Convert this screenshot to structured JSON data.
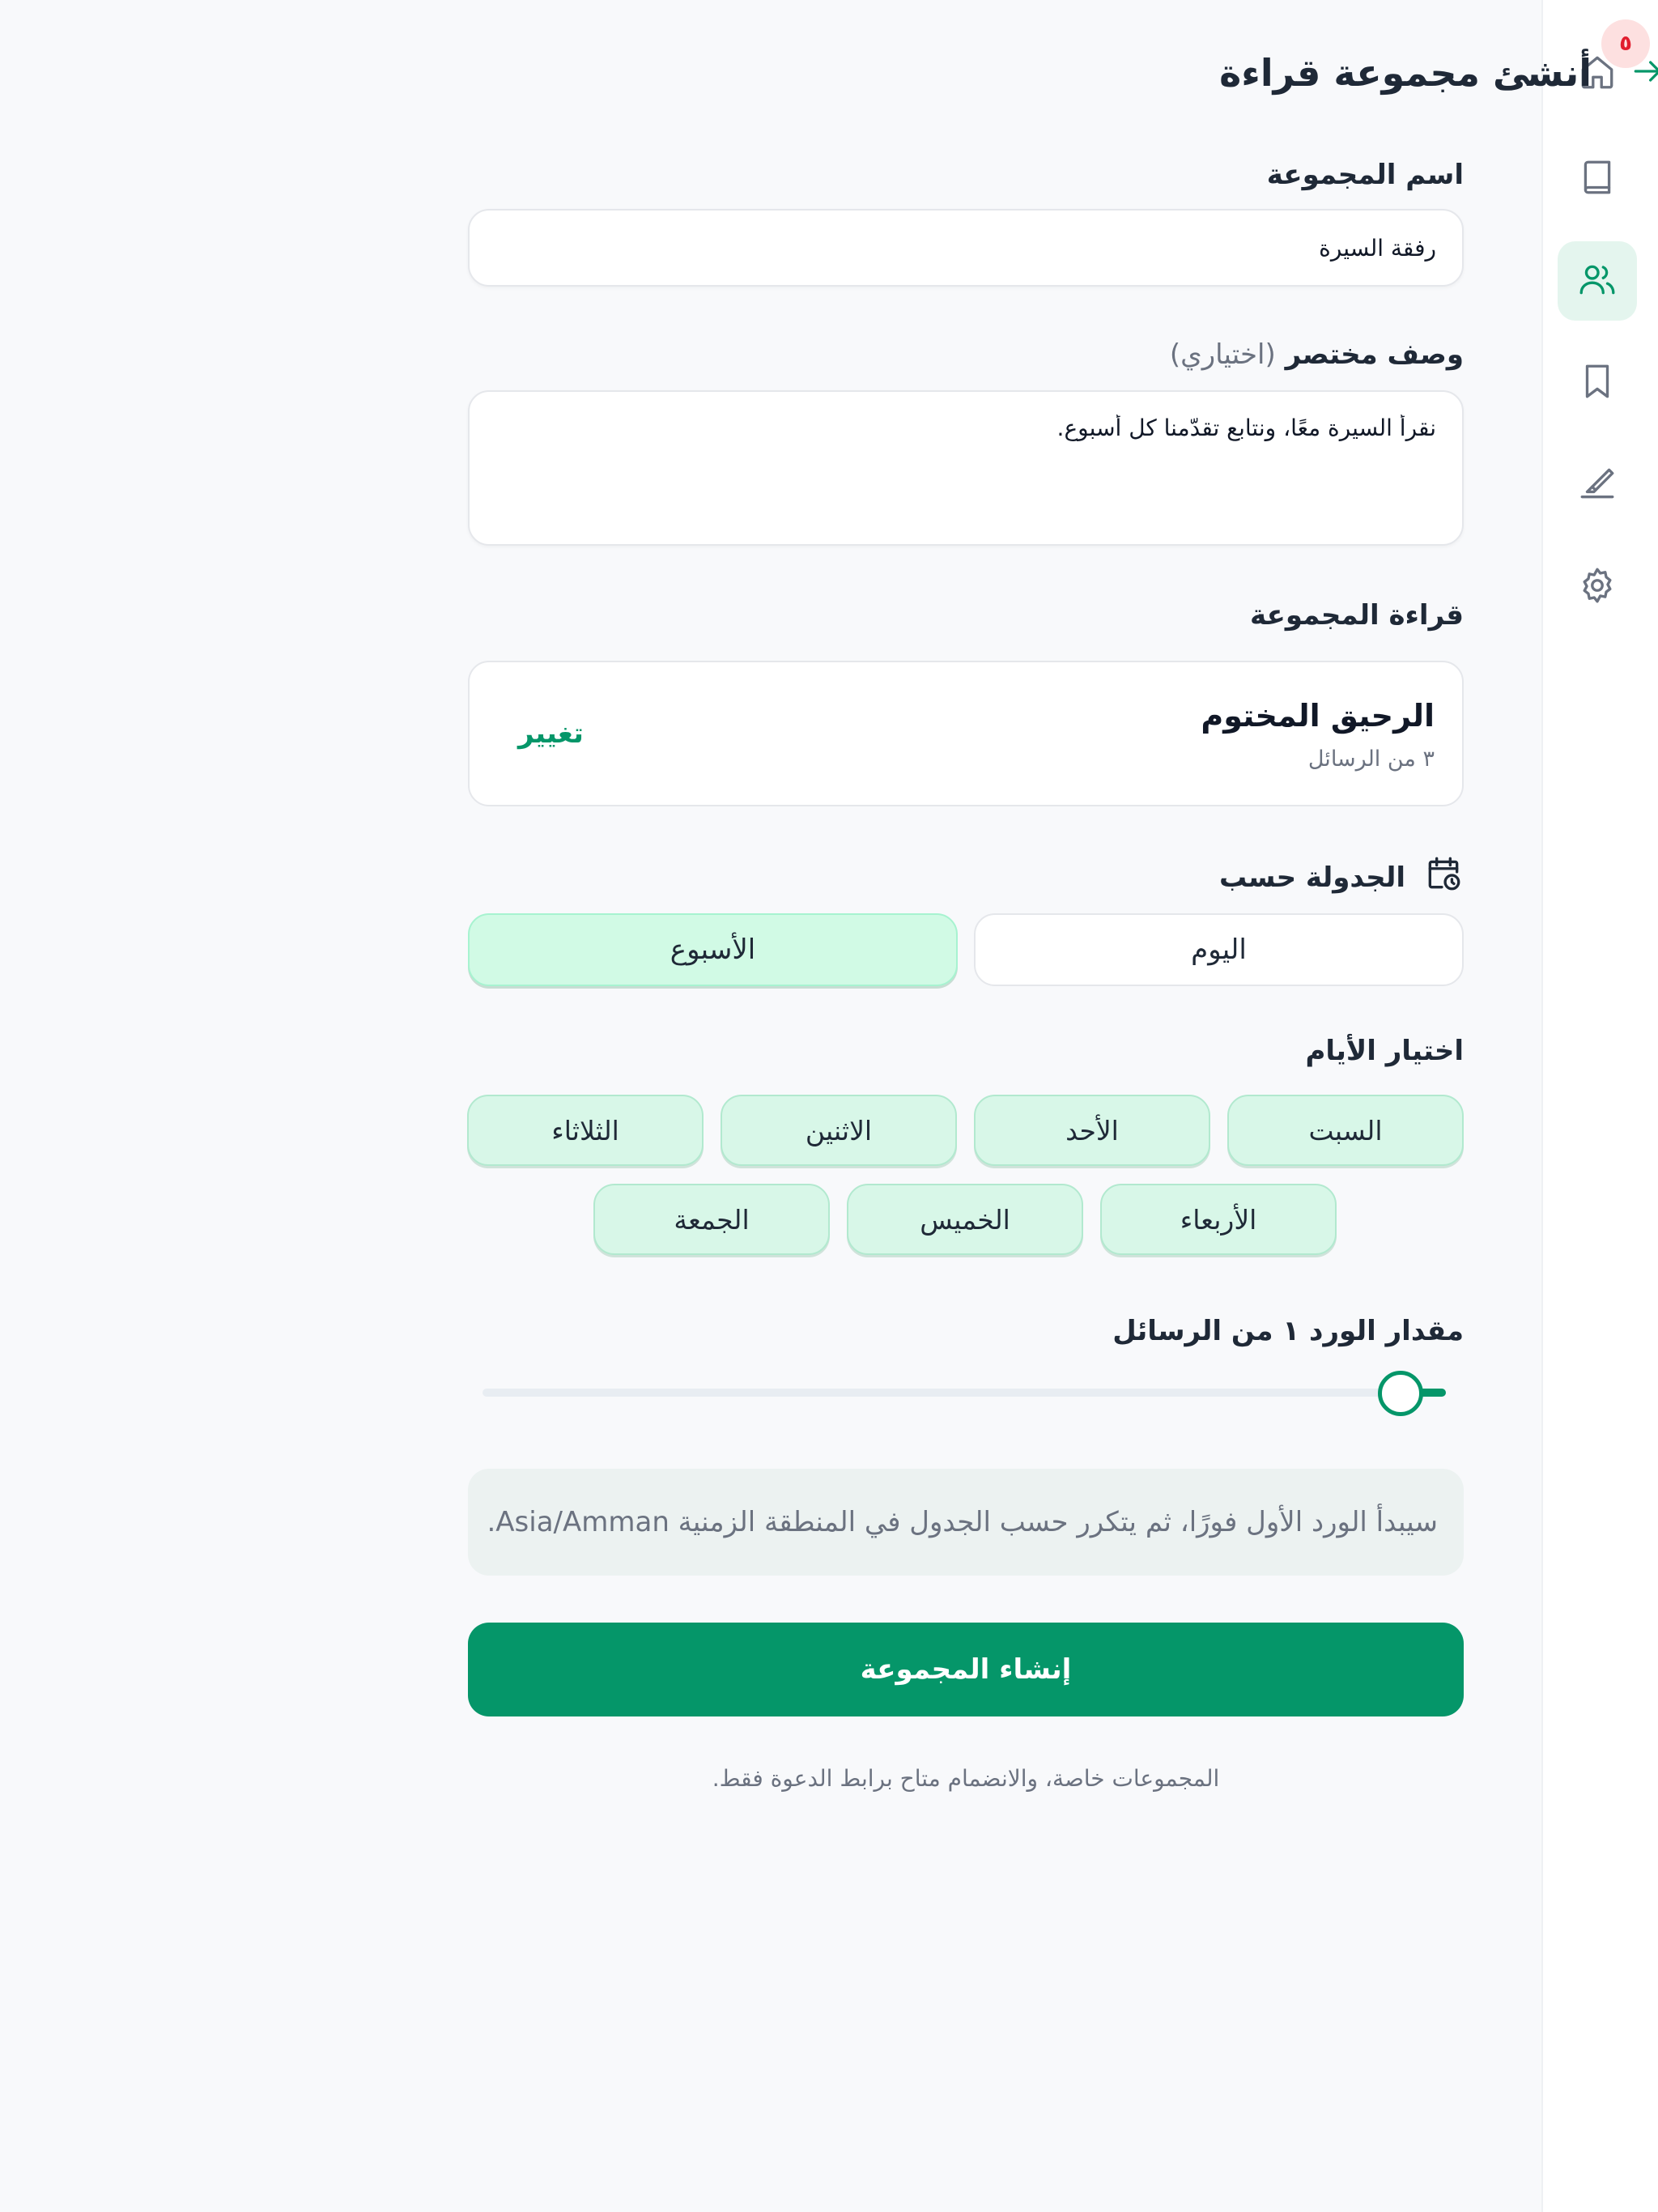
{
  "header": {
    "title": "أنشئ مجموعة قراءة"
  },
  "nav": {
    "badge": "٥",
    "items": [
      "home-icon",
      "book-icon",
      "users-icon",
      "bookmark-icon",
      "highlighter-icon",
      "gear-icon"
    ],
    "active": "users-icon"
  },
  "form": {
    "name_label": "اسم المجموعة",
    "name_value": "رفقة السيرة",
    "desc_label": "وصف مختصر",
    "desc_optional": "(اختياري)",
    "desc_value": "نقرأ السيرة معًا، ونتابع تقدّمنا كل أسبوع.",
    "reading_label": "قراءة المجموعة",
    "book_title": "الرحيق المختوم",
    "book_sub": "٣ من الرسائل",
    "change_label": "تغيير",
    "schedule_label": "الجدولة حسب",
    "schedule_options": [
      "اليوم",
      "الأسبوع"
    ],
    "schedule_selected": "الأسبوع",
    "days_label": "اختيار الأيام",
    "days": [
      "السبت",
      "الأحد",
      "الاثنين",
      "الثلاثاء",
      "الأربعاء",
      "الخميس",
      "الجمعة"
    ],
    "amount_label": "مقدار الورد ١ من الرسائل",
    "amount_value": 1,
    "info_text": "سيبدأ الورد الأول فورًا، ثم يتكرر حسب الجدول في المنطقة الزمنية Asia/Amman.",
    "submit_label": "إنشاء المجموعة",
    "footer_note": "المجموعات خاصة، والانضمام متاح برابط الدعوة فقط."
  },
  "colors": {
    "accent": "#059669",
    "chip_bg": "#d8f7e8",
    "badge": "#e11d2e"
  }
}
